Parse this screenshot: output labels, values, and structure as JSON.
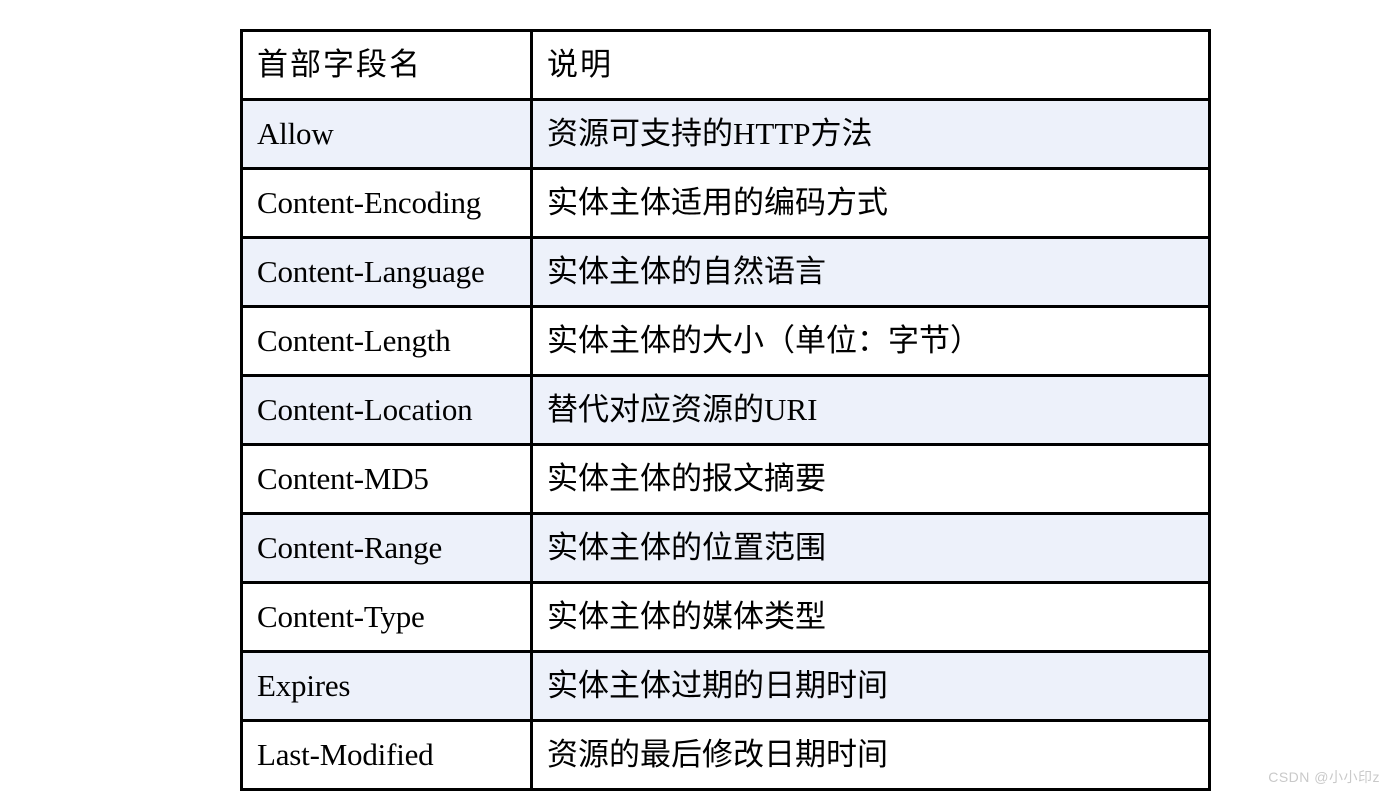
{
  "table": {
    "columns": [
      "首部字段名",
      "说明"
    ],
    "rows": [
      {
        "field": "Allow",
        "description": "资源可支持的HTTP方法"
      },
      {
        "field": "Content-Encoding",
        "description": "实体主体适用的编码方式"
      },
      {
        "field": "Content-Language",
        "description": "实体主体的自然语言"
      },
      {
        "field": "Content-Length",
        "description": "实体主体的大小（单位：字节）"
      },
      {
        "field": "Content-Location",
        "description": "替代对应资源的URI"
      },
      {
        "field": "Content-MD5",
        "description": "实体主体的报文摘要"
      },
      {
        "field": "Content-Range",
        "description": "实体主体的位置范围"
      },
      {
        "field": "Content-Type",
        "description": "实体主体的媒体类型"
      },
      {
        "field": "Expires",
        "description": "实体主体过期的日期时间"
      },
      {
        "field": "Last-Modified",
        "description": "资源的最后修改日期时间"
      }
    ]
  },
  "watermark": {
    "text": "CSDN @小小印z"
  },
  "colors": {
    "border": "#000000",
    "shaded_row": "#edf1fa",
    "plain_row": "#ffffff",
    "text": "#000000",
    "watermark": "#c9c9c9"
  }
}
